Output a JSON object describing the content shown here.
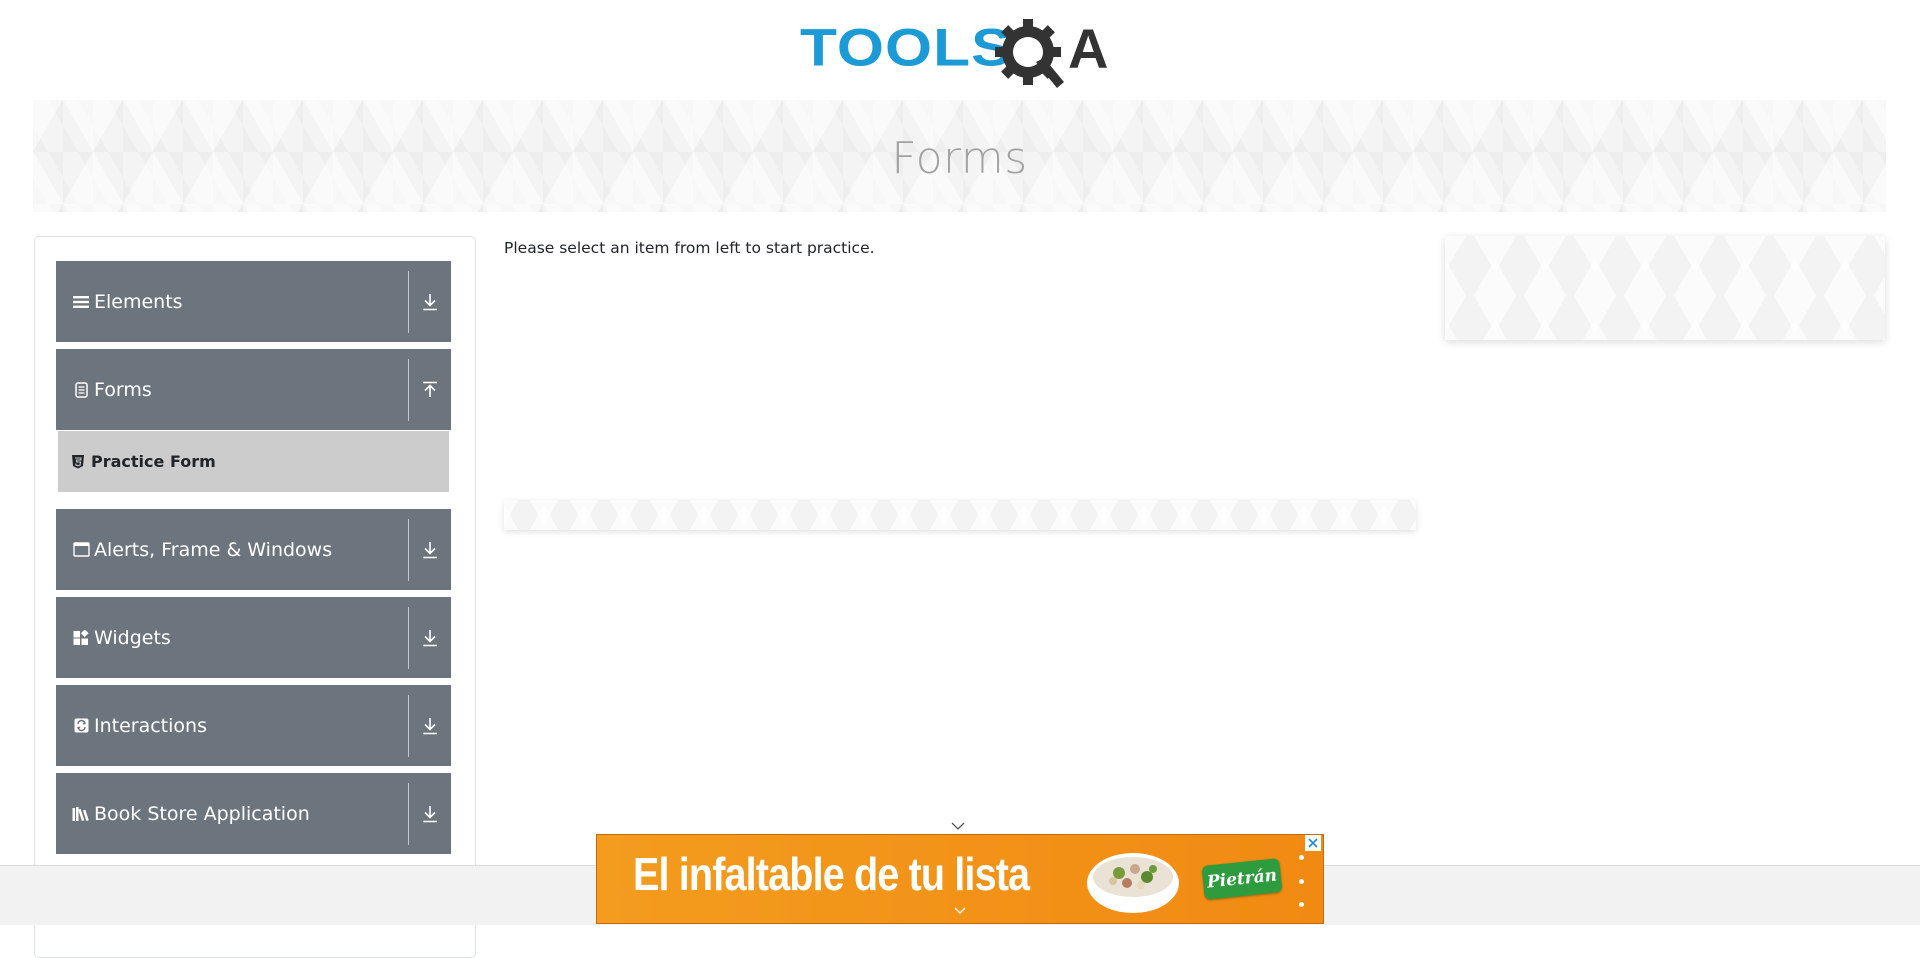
{
  "logo": {
    "brand_left": "TOOLS",
    "brand_right": "A"
  },
  "banner": {
    "title": "Forms"
  },
  "sidebar": {
    "groups": [
      {
        "label": "Elements",
        "icon": "list-icon",
        "arrow": "download-arrow-icon"
      },
      {
        "label": "Forms",
        "icon": "document-icon",
        "arrow": "upload-arrow-icon"
      },
      {
        "label": "Alerts, Frame & Windows",
        "icon": "window-icon",
        "arrow": "download-arrow-icon"
      },
      {
        "label": "Widgets",
        "icon": "widgets-icon",
        "arrow": "download-arrow-icon"
      },
      {
        "label": "Interactions",
        "icon": "interactions-icon",
        "arrow": "download-arrow-icon"
      },
      {
        "label": "Book Store Application",
        "icon": "books-icon",
        "arrow": "download-arrow-icon"
      }
    ],
    "forms_items": [
      {
        "label": "Practice Form",
        "icon": "html5-icon"
      }
    ]
  },
  "main": {
    "instruction": "Please select an item from left to start practice."
  },
  "ad": {
    "headline": "El infaltable de tu lista",
    "brand": "Pietrán",
    "accent": "#f18a12",
    "brand_color": "#2e9b3e"
  },
  "colors": {
    "sidebar_header_bg": "#6c757d",
    "active_item_bg": "#cccccc",
    "logo_blue": "#1b9ad6",
    "logo_dark": "#333333"
  }
}
